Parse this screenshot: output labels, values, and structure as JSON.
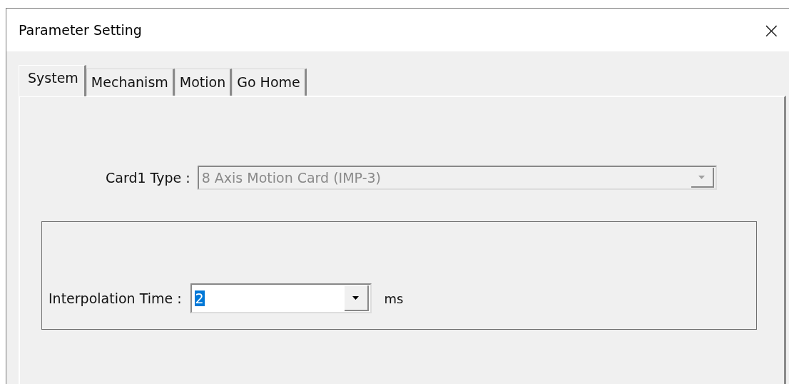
{
  "window": {
    "title": "Parameter Setting",
    "close": "×"
  },
  "tabs": [
    {
      "label": "System",
      "selected": true
    },
    {
      "label": "Mechanism",
      "selected": false
    },
    {
      "label": "Motion",
      "selected": false
    },
    {
      "label": "Go Home",
      "selected": false
    }
  ],
  "card_type": {
    "label": "Card1 Type :",
    "value": "8 Axis Motion Card (IMP-3)",
    "disabled": true
  },
  "interpolation_time": {
    "label": "Interpolation Time :",
    "value": "2",
    "value_selected": true,
    "unit": "ms"
  }
}
